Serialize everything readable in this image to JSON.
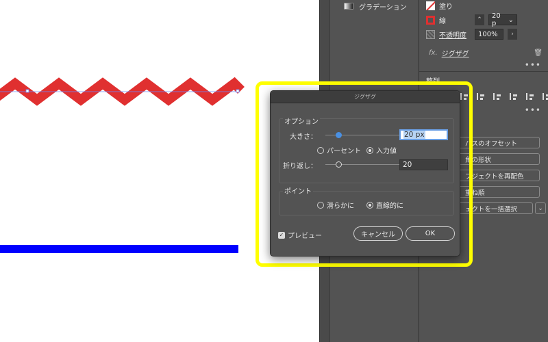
{
  "colors": {
    "stroke": "#e03030",
    "blue_line": "#0000ff",
    "highlight": "#ffff00",
    "slider_knob": "#4a90e2"
  },
  "mid_panel": {
    "gradient_label": "グラデーション",
    "gradient_icon": "gradient-swatch-icon"
  },
  "appearance": {
    "fill_label": "塗り",
    "stroke_label": "線",
    "stroke_weight": "20 p",
    "opacity_label": "不透明度",
    "opacity_value": "100%",
    "effect_prefix": "fx.",
    "effect_name": "ジグザグ",
    "more": "•••"
  },
  "align": {
    "label": "整列",
    "more": "•••"
  },
  "quick_actions": {
    "offset_path": "パスのオフセット",
    "corner_shape": "角の形状",
    "recolor": "ブジェクトを再配色",
    "arrange": "重ね順",
    "select_same": "ェクトを一括選択"
  },
  "dialog": {
    "title": "ジグザグ",
    "options_label": "オプション",
    "size_label": "大きさ：",
    "size_value": "20 px",
    "size_slider_level": 0.18,
    "percent_label": "パーセント",
    "absolute_label": "入力値",
    "ridges_label": "折り返し：",
    "ridges_value": "20",
    "ridges_slider_level": 0.18,
    "points_label": "ポイント",
    "smooth_label": "滑らかに",
    "corner_label": "直線的に",
    "preview_label": "プレビュー",
    "cancel_label": "キャンセル",
    "ok_label": "OK"
  }
}
